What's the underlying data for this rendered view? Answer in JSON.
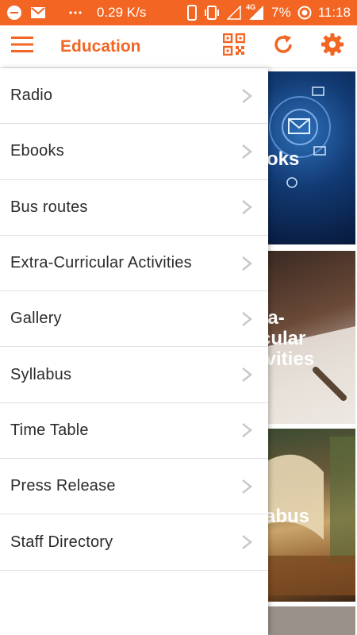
{
  "status_bar": {
    "speed": "0.29 K/s",
    "network": "4G",
    "battery": "7%",
    "time": "11:18"
  },
  "app_bar": {
    "title": "Education",
    "icons": [
      "menu-icon",
      "qr-code-icon",
      "refresh-icon",
      "gear-icon"
    ]
  },
  "colors": {
    "accent": "#f26522",
    "status_bar_bg": "#f26522",
    "drawer_bg": "#ffffff",
    "divider": "#e0e0e0",
    "chevron": "#c8c8c8"
  },
  "drawer": {
    "items": [
      {
        "label": "Radio"
      },
      {
        "label": "Ebooks"
      },
      {
        "label": "Bus routes"
      },
      {
        "label": "Extra-Curricular Activities"
      },
      {
        "label": "Gallery"
      },
      {
        "label": "Syllabus"
      },
      {
        "label": "Time Table"
      },
      {
        "label": "Press Release"
      },
      {
        "label": "Staff Directory"
      }
    ]
  },
  "content": {
    "cards": [
      {
        "label": "oks"
      },
      {
        "label": "ra-\ncular\nivities"
      },
      {
        "label": "abus"
      }
    ]
  }
}
